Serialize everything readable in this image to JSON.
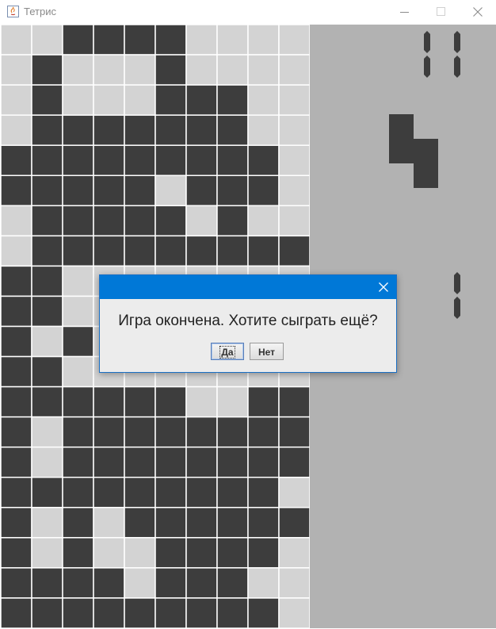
{
  "window": {
    "title": "Тетрис",
    "minimize_label": "minimize",
    "maximize_label": "maximize",
    "close_label": "close"
  },
  "board": {
    "columns": 10,
    "rows": 20,
    "empty_color": "#d3d3d3",
    "filled_color": "#3d3d3d",
    "grid_color": "#ffffff",
    "cells": [
      "0011110000",
      "0100010000",
      "0100011100",
      "0111111100",
      "1111111110",
      "1111101110",
      "0111110100",
      "0111111111",
      "1100000000",
      "1100000000",
      "1010000000",
      "1100000000",
      "1111110011",
      "1011111111",
      "1011111111",
      "1111111110",
      "1010111111",
      "1010011110",
      "1111011100",
      "1111111110"
    ]
  },
  "side_panel": {
    "background": "#b2b2b2",
    "score_digits": "11",
    "level_digit": "1",
    "next_piece": {
      "name": "S-piece",
      "cells": [
        "10",
        "11",
        "01"
      ],
      "color": "#3d3d3d"
    }
  },
  "dialog": {
    "message": "Игра окончена. Хотите сыграть ещё?",
    "yes_label": "Да",
    "no_label": "Нет",
    "close_icon": "close-icon",
    "title_color": "#0078d7"
  }
}
